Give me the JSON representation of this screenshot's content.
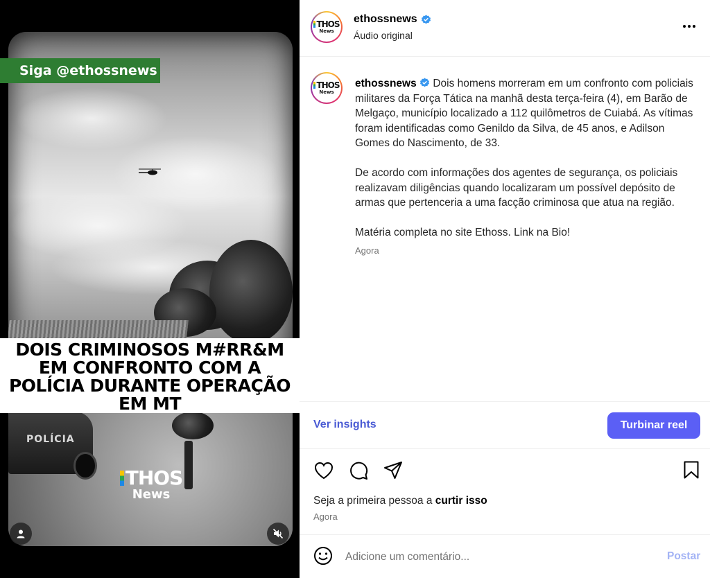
{
  "video": {
    "follow_tag": "Siga @ethossnews",
    "headline_lines": [
      "DOIS CRIMINOSOS M#RR&M",
      "EM CONFRONTO COM A",
      "POLÍCIA DURANTE OPERAÇÃO",
      "EM MT"
    ],
    "car_text": "POLÍCIA",
    "watermark_top": "THOS",
    "watermark_bottom": "News",
    "user_icon": "user-icon",
    "mute_icon": "speaker-muted-icon"
  },
  "header": {
    "avatar_top": "THOS",
    "avatar_bottom": "News",
    "username": "ethossnews",
    "subtitle": "Áudio original",
    "more_icon": "more-horizontal-icon"
  },
  "caption": {
    "username": "ethossnews",
    "paragraphs": [
      "Dois homens morreram em um confronto com policiais militares da Força Tática na manhã desta terça-feira (4), em Barão de Melgaço, município localizado a 112 quilômetros de Cuiabá. As vítimas foram identificadas como Genildo da Silva, de 45 anos, e Adilson Gomes do Nascimento, de 33.",
      "De acordo com informações dos agentes de segurança, os policiais realizavam diligências quando localizaram um possível depósito de armas que pertenceria a uma facção criminosa que atua na região.",
      "Matéria completa no site Ethoss. Link na Bio!"
    ],
    "time": "Agora"
  },
  "insights": {
    "label": "Ver insights",
    "boost_label": "Turbinar reel"
  },
  "actions": {
    "like_icon": "heart-icon",
    "comment_icon": "comment-icon",
    "share_icon": "share-icon",
    "save_icon": "bookmark-icon"
  },
  "likes": {
    "prefix": "Seja a primeira pessoa a ",
    "link": "curtir isso",
    "time": "Agora"
  },
  "comment": {
    "emoji_icon": "emoji-icon",
    "placeholder": "Adicione um comentário...",
    "post_label": "Postar"
  },
  "colors": {
    "accent": "#5b5ff5",
    "link": "#4a5bd4",
    "follow_tag_bg": "#2e7d32",
    "verified": "#3897f0"
  }
}
